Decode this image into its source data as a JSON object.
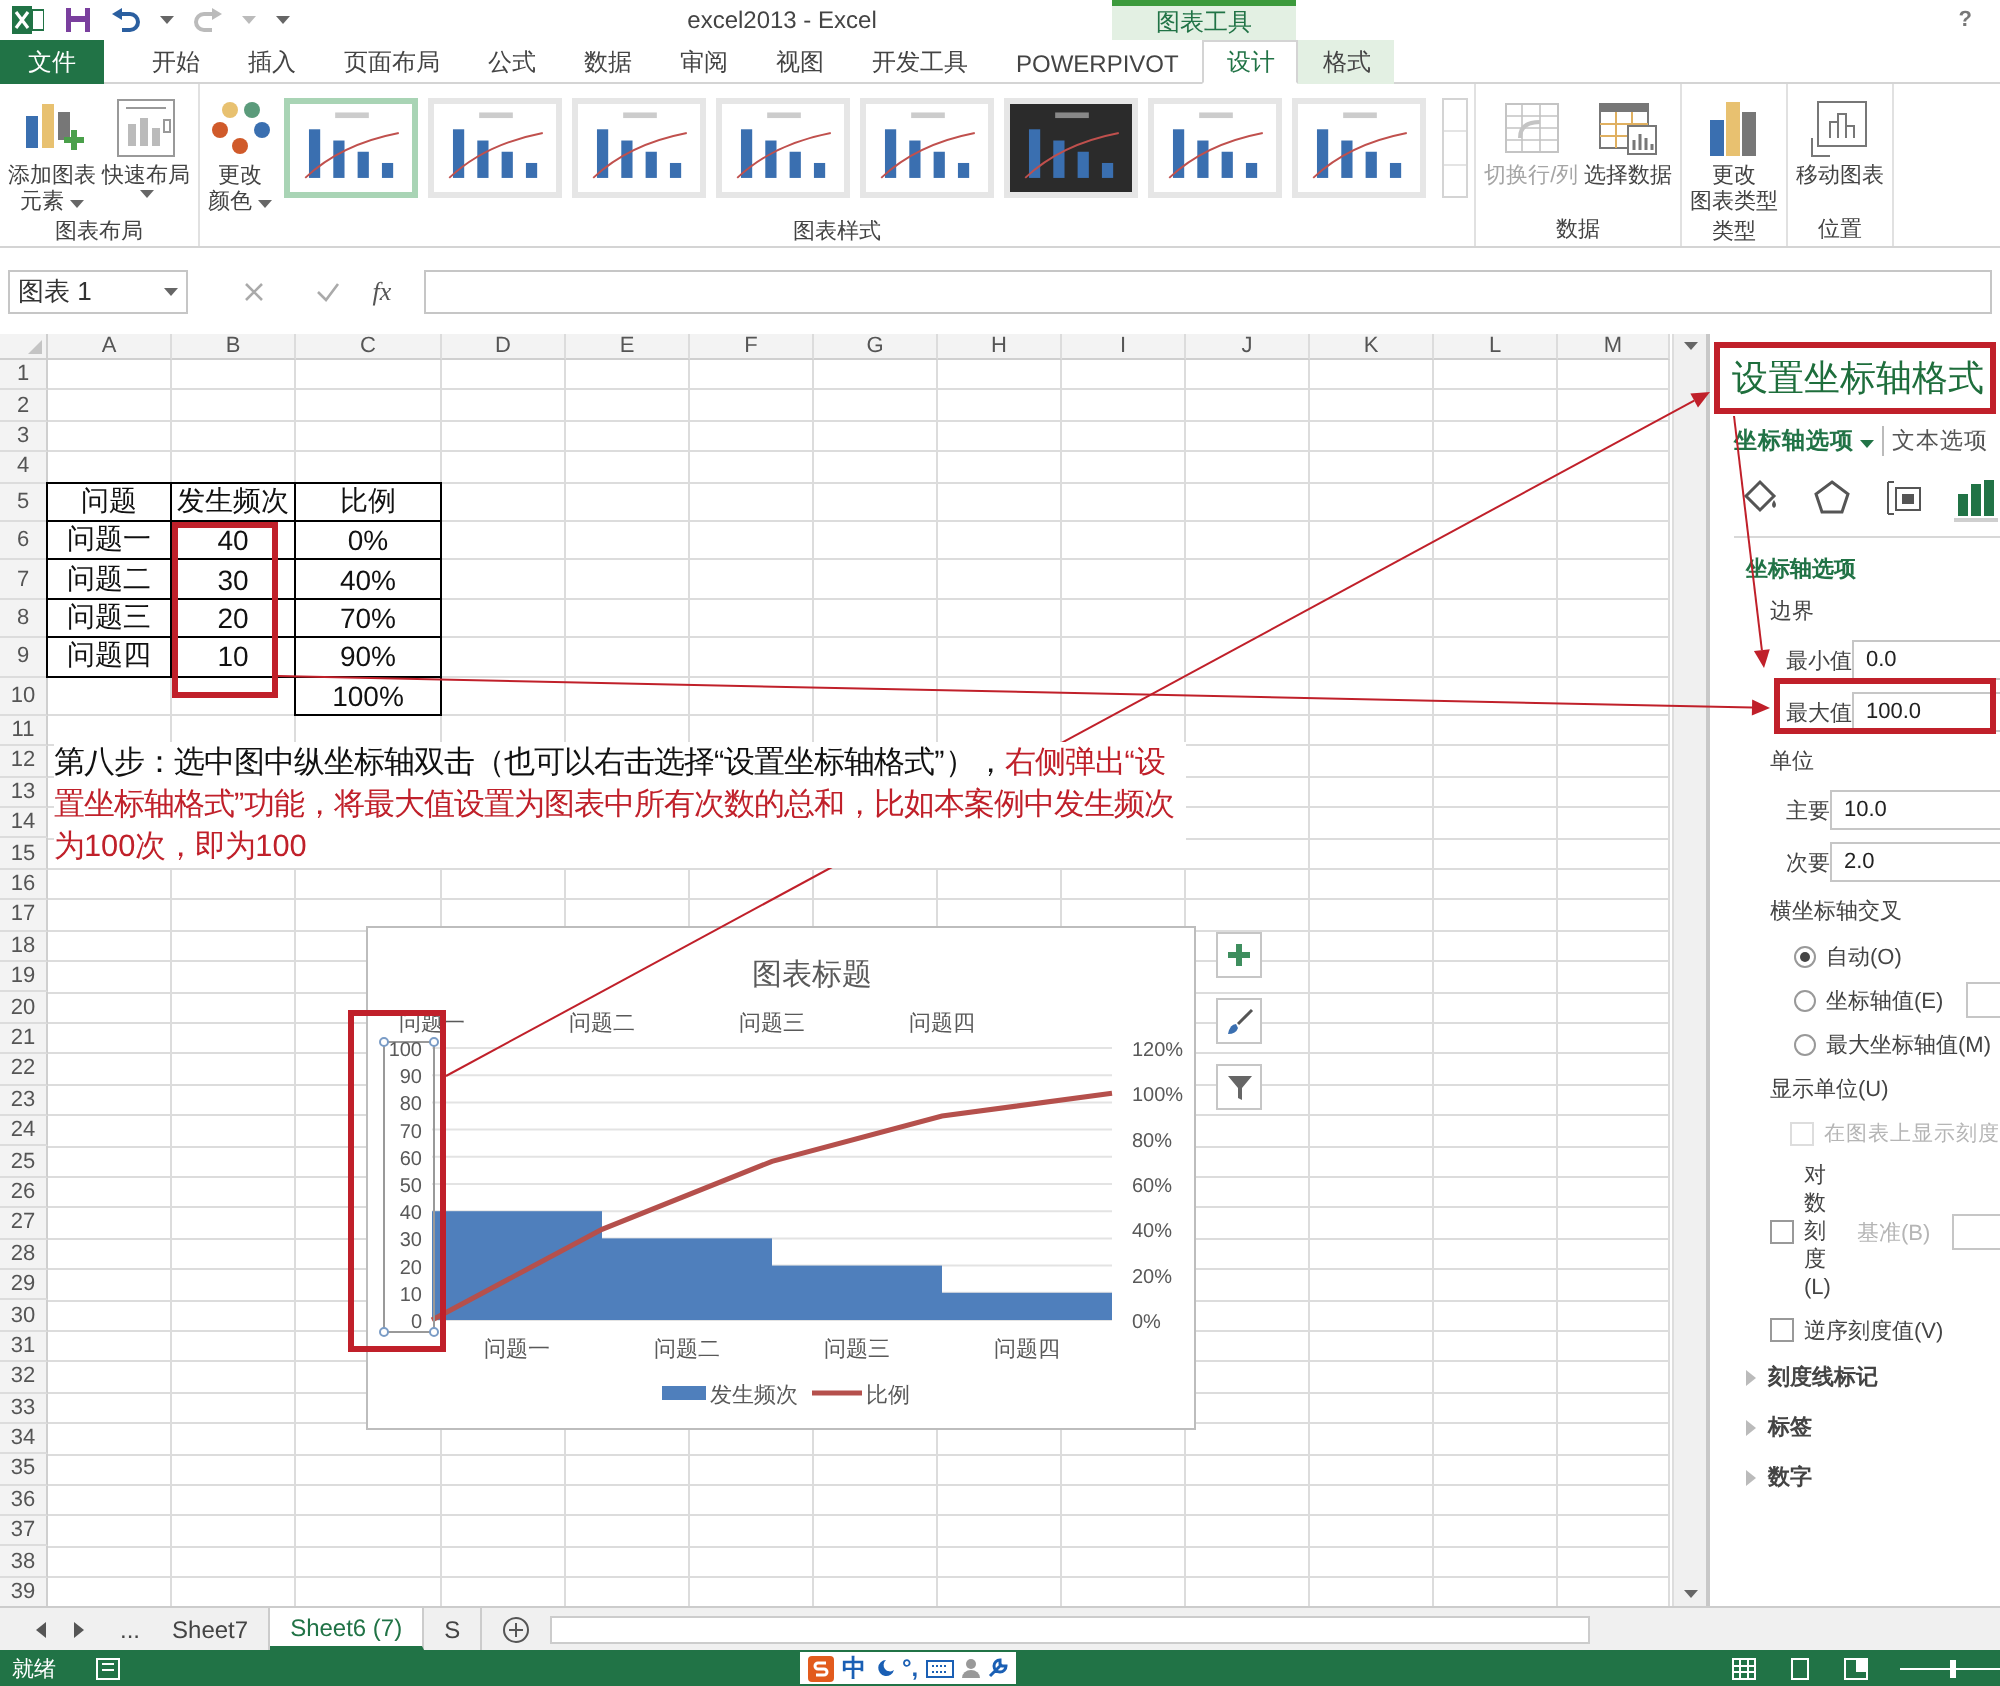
{
  "title_bar": {
    "title": "excel2013 - Excel",
    "context_label": "图表工具",
    "help": "?"
  },
  "tabs": [
    {
      "label": "文件",
      "kind": "file",
      "selected": false
    },
    {
      "label": "开始",
      "kind": "plain",
      "selected": false
    },
    {
      "label": "插入",
      "kind": "plain",
      "selected": false
    },
    {
      "label": "页面布局",
      "kind": "plain",
      "selected": false
    },
    {
      "label": "公式",
      "kind": "plain",
      "selected": false
    },
    {
      "label": "数据",
      "kind": "plain",
      "selected": false
    },
    {
      "label": "审阅",
      "kind": "plain",
      "selected": false
    },
    {
      "label": "视图",
      "kind": "plain",
      "selected": false
    },
    {
      "label": "开发工具",
      "kind": "plain",
      "selected": false
    },
    {
      "label": "POWERPIVOT",
      "kind": "plain",
      "selected": false
    },
    {
      "label": "设计",
      "kind": "context",
      "selected": true
    },
    {
      "label": "格式",
      "kind": "context",
      "selected": false
    }
  ],
  "ribbon": {
    "groups": [
      {
        "label": "图表布局",
        "buttons": [
          {
            "lines": [
              "添加图表",
              "元素"
            ],
            "menu": true,
            "disabled": false
          },
          {
            "lines": [
              "快速布局"
            ],
            "menu": true,
            "disabled": false
          }
        ]
      },
      {
        "label": "图表样式",
        "buttons": [
          {
            "lines": [
              "更改",
              "颜色"
            ],
            "menu": true,
            "disabled": false
          }
        ],
        "gallery": [
          {
            "kind": "light",
            "selected": true
          },
          {
            "kind": "light",
            "selected": false
          },
          {
            "kind": "light",
            "selected": false
          },
          {
            "kind": "light",
            "selected": false
          },
          {
            "kind": "light",
            "selected": false
          },
          {
            "kind": "dark",
            "selected": false
          },
          {
            "kind": "light",
            "selected": false
          },
          {
            "kind": "light",
            "selected": false
          }
        ]
      },
      {
        "label": "数据",
        "buttons": [
          {
            "lines": [
              "切换行/列"
            ],
            "menu": false,
            "disabled": true
          },
          {
            "lines": [
              "选择数据"
            ],
            "menu": false,
            "disabled": false
          }
        ]
      },
      {
        "label": "类型",
        "buttons": [
          {
            "lines": [
              "更改",
              "图表类型"
            ],
            "menu": false,
            "disabled": false
          }
        ]
      },
      {
        "label": "位置",
        "buttons": [
          {
            "lines": [
              "移动图表"
            ],
            "menu": false,
            "disabled": false
          }
        ]
      }
    ]
  },
  "formula_bar": {
    "name_box": "图表 1",
    "function_label": "fx"
  },
  "sheet": {
    "columns": [
      "A",
      "B",
      "C",
      "D",
      "E",
      "F",
      "G",
      "H",
      "I",
      "J",
      "K",
      "L",
      "M"
    ],
    "rows": [
      "1",
      "2",
      "3",
      "4",
      "5",
      "6",
      "7",
      "8",
      "9",
      "10",
      "11",
      "12",
      "13",
      "14",
      "15",
      "16",
      "17",
      "18",
      "19",
      "20",
      "21",
      "22",
      "23",
      "24",
      "25",
      "26",
      "27",
      "28",
      "29",
      "30",
      "31",
      "32",
      "33",
      "34",
      "35",
      "36",
      "37",
      "38",
      "39"
    ],
    "table": {
      "header": [
        "问题",
        "发生频次",
        "比例"
      ],
      "rows": [
        [
          "问题一",
          "40",
          "0%"
        ],
        [
          "问题二",
          "30",
          "40%"
        ],
        [
          "问题三",
          "20",
          "70%"
        ],
        [
          "问题四",
          "10",
          "90%"
        ]
      ],
      "total": "100%"
    },
    "instruction": {
      "text": "第八步：选中图中纵坐标轴双击（也可以右击选择“设置坐标轴格式”），",
      "highlight": "右侧弹出“设置坐标轴格式”功能，将最大值设置为图表中所有次数的总和，比如本案例中发生频次为100次，即为100"
    }
  },
  "chart": {
    "title": "图表标题",
    "top_axis_labels": [
      "问题一",
      "问题二",
      "问题三",
      "问题四"
    ],
    "chart_data": {
      "type": "bar",
      "categories": [
        "问题一",
        "问题二",
        "问题三",
        "问题四"
      ],
      "grid": true,
      "series": [
        {
          "name": "发生频次",
          "color": "#4f7fbc",
          "values": [
            40,
            30,
            20,
            10
          ]
        }
      ],
      "ylim": [
        0,
        100
      ],
      "yticks": [
        0,
        10,
        20,
        30,
        40,
        50,
        60,
        70,
        80,
        90,
        100
      ]
    },
    "line": {
      "name": "比例",
      "color": "#b5504c"
    },
    "secondary_axis_labels": [
      "120%",
      "100%",
      "80%",
      "60%",
      "40%",
      "20%",
      "0%"
    ]
  },
  "format_pane": {
    "title": "设置坐标轴格式",
    "tabs": [
      {
        "label": "坐标轴选项",
        "selected": true
      },
      {
        "label": "文本选项",
        "selected": false
      }
    ],
    "icon_tabs": [
      {
        "kind": "fill",
        "selected": false
      },
      {
        "kind": "effects",
        "selected": false
      },
      {
        "kind": "size",
        "selected": false
      },
      {
        "kind": "axis",
        "selected": true
      }
    ],
    "section": "坐标轴选项",
    "items": [
      {
        "kind": "group",
        "label": "边界"
      },
      {
        "kind": "field",
        "label": "最小值",
        "value": "0.0"
      },
      {
        "kind": "field",
        "label": "最大值",
        "value": "100.0"
      },
      {
        "kind": "group",
        "label": "单位"
      },
      {
        "kind": "field",
        "label": "主要",
        "value": "10.0"
      },
      {
        "kind": "field",
        "label": "次要",
        "value": "2.0"
      },
      {
        "kind": "group",
        "label": "横坐标轴交叉"
      },
      {
        "kind": "radio",
        "label": "自动(O)",
        "selected": true
      },
      {
        "kind": "radio_field",
        "label": "坐标轴值(E)",
        "selected": false
      },
      {
        "kind": "radio",
        "label": "最大坐标轴值(M)",
        "selected": false
      },
      {
        "kind": "group",
        "label": "显示单位(U)"
      },
      {
        "kind": "checkbox",
        "label": "在图表上显示刻度",
        "checked": false,
        "disabled": true
      },
      {
        "kind": "checkbox",
        "label": "对数刻度(L)",
        "checked": false,
        "disabled": false,
        "extra": "基准(B)"
      },
      {
        "kind": "checkbox",
        "label": "逆序刻度值(V)",
        "checked": false,
        "disabled": false
      },
      {
        "kind": "section",
        "label": "刻度线标记",
        "expanded": false
      },
      {
        "kind": "section",
        "label": "标签",
        "expanded": false
      },
      {
        "kind": "section",
        "label": "数字",
        "expanded": false
      }
    ]
  },
  "sheet_tabs": {
    "more": "...",
    "items": [
      {
        "label": "Sheet7",
        "selected": false
      },
      {
        "label": "Sheet6 (7)",
        "selected": true
      },
      {
        "label": "S",
        "selected": false
      }
    ]
  },
  "status_bar": {
    "ready": "就绪",
    "ime": "中",
    "ime_punct": "°,",
    "zoom": {
      "level": 0.5
    }
  }
}
